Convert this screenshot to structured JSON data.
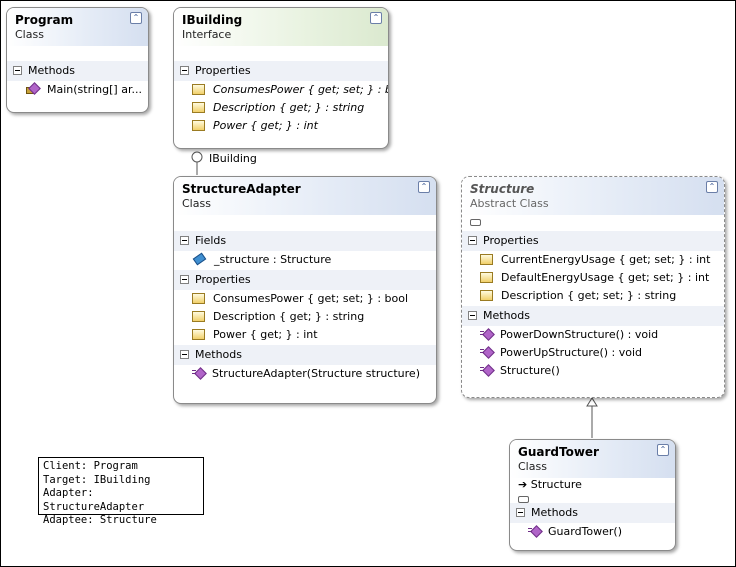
{
  "program": {
    "name": "Program",
    "stereotype": "Class",
    "sections": [
      {
        "label": "Methods",
        "members": [
          {
            "text": "Main(string[] ar...",
            "icon": "static-method-icon"
          }
        ]
      }
    ]
  },
  "ibuilding": {
    "name": "IBuilding",
    "stereotype": "Interface",
    "sections": [
      {
        "label": "Properties",
        "members": [
          {
            "text": "ConsumesPower { get; set; } : bool",
            "icon": "property-icon"
          },
          {
            "text": "Description { get; } : string",
            "icon": "property-icon"
          },
          {
            "text": "Power { get; } : int",
            "icon": "property-icon"
          }
        ]
      }
    ]
  },
  "lollipop_label": "IBuilding",
  "structure_adapter": {
    "name": "StructureAdapter",
    "stereotype": "Class",
    "sections": [
      {
        "label": "Fields",
        "members": [
          {
            "text": "_structure : Structure",
            "icon": "field-icon"
          }
        ]
      },
      {
        "label": "Properties",
        "members": [
          {
            "text": "ConsumesPower { get; set; } : bool",
            "icon": "property-icon"
          },
          {
            "text": "Description { get; } : string",
            "icon": "property-icon"
          },
          {
            "text": "Power { get; } : int",
            "icon": "property-icon"
          }
        ]
      },
      {
        "label": "Methods",
        "members": [
          {
            "text": "StructureAdapter(Structure structure)",
            "icon": "method-icon"
          }
        ]
      }
    ]
  },
  "structure": {
    "name": "Structure",
    "stereotype": "Abstract Class",
    "sections": [
      {
        "label": "Properties",
        "members": [
          {
            "text": "CurrentEnergyUsage { get; set; } : int",
            "icon": "property-icon"
          },
          {
            "text": "DefaultEnergyUsage { get; set; } : int",
            "icon": "property-icon"
          },
          {
            "text": "Description { get; set; } : string",
            "icon": "property-icon"
          }
        ]
      },
      {
        "label": "Methods",
        "members": [
          {
            "text": "PowerDownStructure() : void",
            "icon": "method-icon"
          },
          {
            "text": "PowerUpStructure() : void",
            "icon": "method-icon"
          },
          {
            "text": "Structure()",
            "icon": "method-icon"
          }
        ]
      }
    ]
  },
  "guard_tower": {
    "name": "GuardTower",
    "stereotype": "Class",
    "base": "Structure",
    "sections": [
      {
        "label": "Methods",
        "members": [
          {
            "text": "GuardTower()",
            "icon": "method-icon"
          }
        ]
      }
    ]
  },
  "legend": {
    "lines": [
      "Client: Program",
      "Target: IBuilding",
      "Adapter: StructureAdapter",
      "Adaptee: Structure"
    ]
  },
  "collapse_glyph": "⌃"
}
